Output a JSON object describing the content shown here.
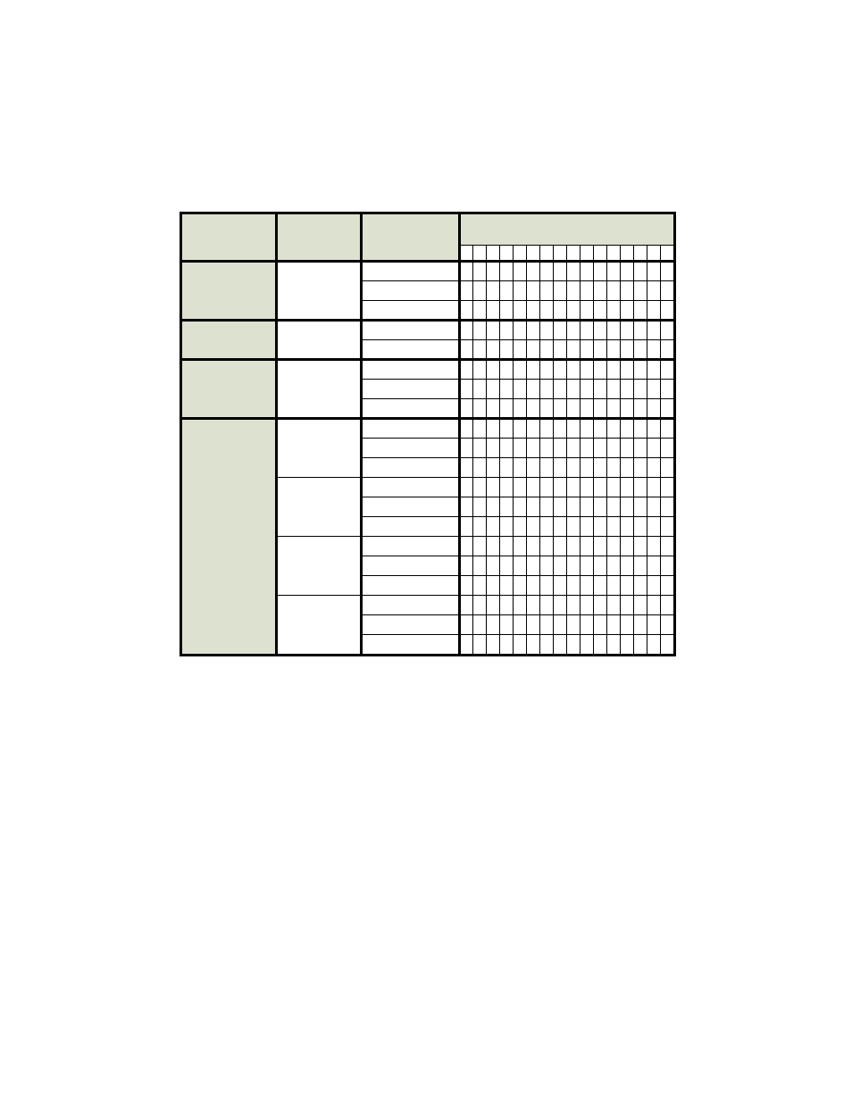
{
  "table": {
    "header_shade_color": "#dde1d0",
    "grid_columns_right": 16,
    "header": {
      "row1": {
        "c0": "",
        "c1": "",
        "c2": "",
        "c3": ""
      },
      "row2_c3_cells": [
        "",
        "",
        "",
        "",
        "",
        "",
        "",
        "",
        "",
        "",
        "",
        "",
        "",
        "",
        "",
        ""
      ]
    },
    "sections": [
      {
        "c0": "",
        "rows": [
          {
            "c1": "",
            "c2": "",
            "grid": [
              "",
              "",
              "",
              "",
              "",
              "",
              "",
              "",
              "",
              "",
              "",
              "",
              "",
              "",
              "",
              ""
            ]
          },
          {
            "c2": "",
            "grid": [
              "",
              "",
              "",
              "",
              "",
              "",
              "",
              "",
              "",
              "",
              "",
              "",
              "",
              "",
              "",
              ""
            ]
          },
          {
            "c2": "",
            "grid": [
              "",
              "",
              "",
              "",
              "",
              "",
              "",
              "",
              "",
              "",
              "",
              "",
              "",
              "",
              "",
              ""
            ]
          }
        ]
      },
      {
        "c0": "",
        "rows": [
          {
            "c1": "",
            "c2": "",
            "grid": [
              "",
              "",
              "",
              "",
              "",
              "",
              "",
              "",
              "",
              "",
              "",
              "",
              "",
              "",
              "",
              ""
            ]
          },
          {
            "c2": "",
            "grid": [
              "",
              "",
              "",
              "",
              "",
              "",
              "",
              "",
              "",
              "",
              "",
              "",
              "",
              "",
              "",
              ""
            ]
          }
        ]
      },
      {
        "c0": "",
        "rows": [
          {
            "c1": "",
            "c2": "",
            "grid": [
              "",
              "",
              "",
              "",
              "",
              "",
              "",
              "",
              "",
              "",
              "",
              "",
              "",
              "",
              "",
              ""
            ]
          },
          {
            "c2": "",
            "grid": [
              "",
              "",
              "",
              "",
              "",
              "",
              "",
              "",
              "",
              "",
              "",
              "",
              "",
              "",
              "",
              ""
            ]
          },
          {
            "c2": "",
            "grid": [
              "",
              "",
              "",
              "",
              "",
              "",
              "",
              "",
              "",
              "",
              "",
              "",
              "",
              "",
              "",
              ""
            ]
          }
        ]
      },
      {
        "c0": "",
        "sub": [
          {
            "rows": [
              {
                "c1": "",
                "c2": "",
                "grid": [
                  "",
                  "",
                  "",
                  "",
                  "",
                  "",
                  "",
                  "",
                  "",
                  "",
                  "",
                  "",
                  "",
                  "",
                  "",
                  ""
                ]
              },
              {
                "c2": "",
                "grid": [
                  "",
                  "",
                  "",
                  "",
                  "",
                  "",
                  "",
                  "",
                  "",
                  "",
                  "",
                  "",
                  "",
                  "",
                  "",
                  ""
                ]
              },
              {
                "c2": "",
                "grid": [
                  "",
                  "",
                  "",
                  "",
                  "",
                  "",
                  "",
                  "",
                  "",
                  "",
                  "",
                  "",
                  "",
                  "",
                  "",
                  ""
                ]
              }
            ]
          },
          {
            "rows": [
              {
                "c1": "",
                "c2": "",
                "grid": [
                  "",
                  "",
                  "",
                  "",
                  "",
                  "",
                  "",
                  "",
                  "",
                  "",
                  "",
                  "",
                  "",
                  "",
                  "",
                  ""
                ]
              },
              {
                "c2": "",
                "grid": [
                  "",
                  "",
                  "",
                  "",
                  "",
                  "",
                  "",
                  "",
                  "",
                  "",
                  "",
                  "",
                  "",
                  "",
                  "",
                  ""
                ]
              },
              {
                "c2": "",
                "grid": [
                  "",
                  "",
                  "",
                  "",
                  "",
                  "",
                  "",
                  "",
                  "",
                  "",
                  "",
                  "",
                  "",
                  "",
                  "",
                  ""
                ]
              }
            ]
          },
          {
            "rows": [
              {
                "c1": "",
                "c2": "",
                "grid": [
                  "",
                  "",
                  "",
                  "",
                  "",
                  "",
                  "",
                  "",
                  "",
                  "",
                  "",
                  "",
                  "",
                  "",
                  "",
                  ""
                ]
              },
              {
                "c2": "",
                "grid": [
                  "",
                  "",
                  "",
                  "",
                  "",
                  "",
                  "",
                  "",
                  "",
                  "",
                  "",
                  "",
                  "",
                  "",
                  "",
                  ""
                ]
              },
              {
                "c2": "",
                "grid": [
                  "",
                  "",
                  "",
                  "",
                  "",
                  "",
                  "",
                  "",
                  "",
                  "",
                  "",
                  "",
                  "",
                  "",
                  "",
                  ""
                ]
              }
            ]
          },
          {
            "rows": [
              {
                "c1": "",
                "c2": "",
                "grid": [
                  "",
                  "",
                  "",
                  "",
                  "",
                  "",
                  "",
                  "",
                  "",
                  "",
                  "",
                  "",
                  "",
                  "",
                  "",
                  ""
                ]
              },
              {
                "c2": "",
                "grid": [
                  "",
                  "",
                  "",
                  "",
                  "",
                  "",
                  "",
                  "",
                  "",
                  "",
                  "",
                  "",
                  "",
                  "",
                  "",
                  ""
                ]
              },
              {
                "c2": "",
                "grid": [
                  "",
                  "",
                  "",
                  "",
                  "",
                  "",
                  "",
                  "",
                  "",
                  "",
                  "",
                  "",
                  "",
                  "",
                  "",
                  ""
                ]
              }
            ]
          }
        ]
      }
    ]
  }
}
